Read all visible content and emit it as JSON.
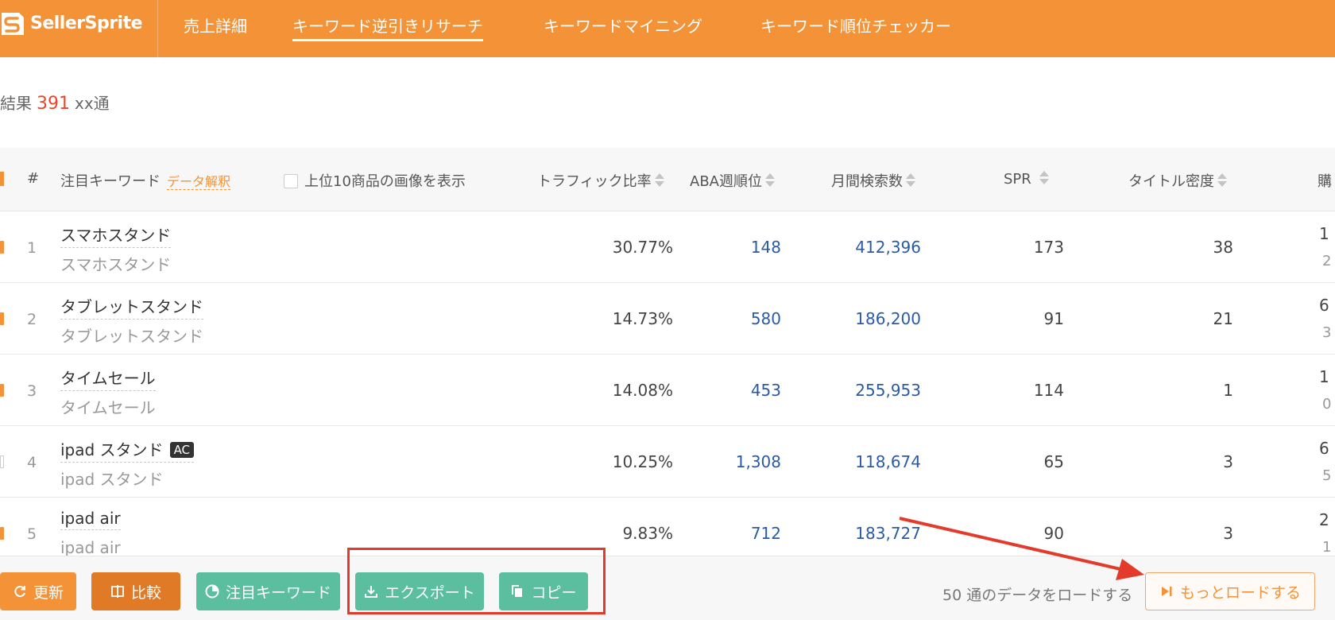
{
  "app": {
    "logo_text": "SellerSprite",
    "brand_color": "#f39237"
  },
  "nav": {
    "tabs": [
      {
        "label": "売上詳細"
      },
      {
        "label": "キーワード逆引きリサーチ",
        "active": true
      },
      {
        "label": "キーワードマイニング"
      },
      {
        "label": "キーワード順位チェッカー"
      }
    ]
  },
  "summary": {
    "prefix": "結果",
    "count": "391",
    "suffix": "xx通"
  },
  "table": {
    "columns": {
      "index": "#",
      "keyword": "注目キーワード",
      "keyword_hint": "データ解釈",
      "show_images": "上位10商品の画像を表示",
      "traffic": "トラフィック比率",
      "aba": "ABA週順位",
      "monthly": "月間検索数",
      "spr": "SPR",
      "title_density": "タイトル密度",
      "purchase": "購"
    },
    "rows": [
      {
        "index": "1",
        "keyword": "スマホスタンド",
        "translation": "スマホスタンド",
        "ac": false,
        "traffic": "30.77%",
        "aba": "148",
        "monthly": "412,396",
        "spr": "173",
        "title_density": "38",
        "p_top": "1",
        "p_bot": "2"
      },
      {
        "index": "2",
        "keyword": "タブレットスタンド",
        "translation": "タブレットスタンド",
        "ac": false,
        "traffic": "14.73%",
        "aba": "580",
        "monthly": "186,200",
        "spr": "91",
        "title_density": "21",
        "p_top": "6",
        "p_bot": "3"
      },
      {
        "index": "3",
        "keyword": "タイムセール",
        "translation": "タイムセール",
        "ac": false,
        "traffic": "14.08%",
        "aba": "453",
        "monthly": "255,953",
        "spr": "114",
        "title_density": "1",
        "p_top": "1",
        "p_bot": "0"
      },
      {
        "index": "4",
        "keyword": "ipad スタンド",
        "translation": "ipad スタンド",
        "ac": true,
        "ac_label": "AC",
        "traffic": "10.25%",
        "aba": "1,308",
        "monthly": "118,674",
        "spr": "65",
        "title_density": "3",
        "p_top": "6",
        "p_bot": "5"
      },
      {
        "index": "5",
        "keyword": "ipad air",
        "translation": "ipad air",
        "ac": false,
        "traffic": "9.83%",
        "aba": "712",
        "monthly": "183,727",
        "spr": "90",
        "title_density": "3",
        "p_top": "2",
        "p_bot": "1"
      }
    ]
  },
  "toolbar": {
    "refresh": "更新",
    "compare": "比較",
    "keywords": "注目キーワード",
    "export": "エクスポート",
    "copy": "コピー",
    "load_info": "50 通のデータをロードする",
    "load_more": "もっとロードする"
  },
  "colors": {
    "highlight": "#e33a2b",
    "accent": "#f39237",
    "green": "#5bbf9f",
    "number_blue": "#2a5aa8",
    "count_red": "#e8472a"
  }
}
